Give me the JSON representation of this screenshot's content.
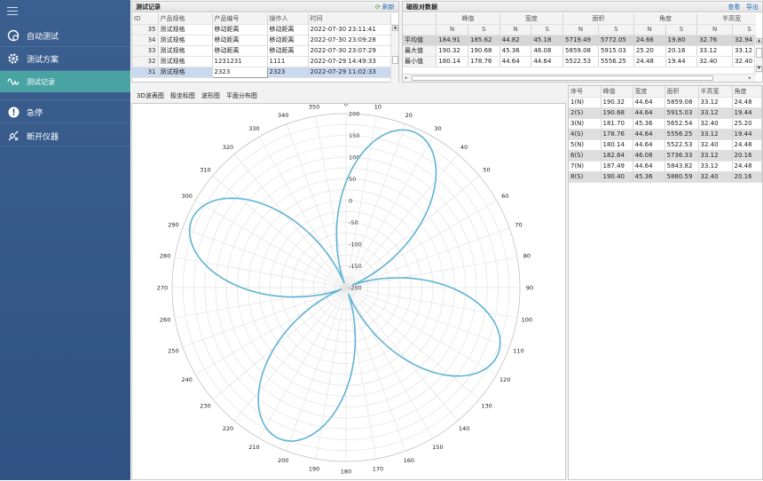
{
  "sidebar": {
    "items": [
      {
        "label": "自动测试",
        "icon": "auto-test-icon"
      },
      {
        "label": "测试方案",
        "icon": "gear-icon"
      },
      {
        "label": "测试记录",
        "icon": "wave-icon"
      },
      {
        "label": "急停",
        "icon": "alert-icon"
      },
      {
        "label": "断开仪器",
        "icon": "disconnect-icon"
      }
    ],
    "active_color": "#4aa3a3"
  },
  "records": {
    "title": "测试记录",
    "refresh_label": "刷新",
    "columns": [
      "ID",
      "产品规格",
      "产品编号",
      "操作人",
      "时间"
    ],
    "rows": [
      [
        "35",
        "测试规格",
        "移动距离",
        "移动距离",
        "2022-07-30 23:11:41"
      ],
      [
        "34",
        "测试规格",
        "移动距离",
        "移动距离",
        "2022-07-30 23:09:28"
      ],
      [
        "33",
        "测试规格",
        "移动距离",
        "移动距离",
        "2022-07-30 23:07:29"
      ],
      [
        "32",
        "测试规格",
        "1231231",
        "1111",
        "2022-07-29 14:49:33"
      ],
      [
        "31",
        "测试规格",
        "2323",
        "2323",
        "2022-07-29 11:02:33"
      ]
    ]
  },
  "magnetic": {
    "title": "磁极对数据",
    "view_label": "查看",
    "export_label": "导出",
    "groups": [
      "峰值",
      "宽度",
      "面积",
      "角度",
      "半高宽"
    ],
    "sub": [
      "N",
      "S",
      "N",
      "S",
      "N",
      "S",
      "N",
      "S",
      "N",
      "S"
    ],
    "rows": [
      {
        "label": "平均值",
        "values": [
          "184.91",
          "185.62",
          "44.82",
          "45.18",
          "5719.49",
          "5772.05",
          "24.66",
          "19.80",
          "32.76",
          "32.94"
        ]
      },
      {
        "label": "最大值",
        "values": [
          "190.32",
          "190.68",
          "45.36",
          "46.08",
          "5859.08",
          "5915.03",
          "25.20",
          "20.16",
          "33.12",
          "33.12"
        ]
      },
      {
        "label": "最小值",
        "values": [
          "180.14",
          "178.76",
          "44.64",
          "44.64",
          "5522.53",
          "5556.25",
          "24.48",
          "19.44",
          "32.40",
          "32.40"
        ]
      }
    ]
  },
  "tabs": [
    "3D波表图",
    "极坐标图",
    "波形图",
    "平面分布图"
  ],
  "results": {
    "columns": [
      "序号",
      "峰值",
      "宽度",
      "面积",
      "半高宽",
      "角度"
    ],
    "rows": [
      [
        "1(N)",
        "190.32",
        "44.64",
        "5859.08",
        "33.12",
        "24.48"
      ],
      [
        "2(S)",
        "190.68",
        "44.64",
        "5915.03",
        "33.12",
        "19.44"
      ],
      [
        "3(N)",
        "181.70",
        "45.36",
        "5652.54",
        "32.40",
        "25.20"
      ],
      [
        "4(S)",
        "178.76",
        "44.64",
        "5556.25",
        "33.12",
        "19.44"
      ],
      [
        "5(N)",
        "180.14",
        "44.64",
        "5522.53",
        "32.40",
        "24.48"
      ],
      [
        "6(S)",
        "182.64",
        "46.08",
        "5736.33",
        "33.12",
        "20.16"
      ],
      [
        "7(N)",
        "187.49",
        "44.64",
        "5843.82",
        "33.12",
        "24.48"
      ],
      [
        "8(S)",
        "190.40",
        "45.36",
        "5880.59",
        "32.40",
        "20.16"
      ]
    ]
  },
  "chart_data": {
    "type": "polar-line",
    "angle_ticks": [
      "0",
      "10",
      "20",
      "30",
      "40",
      "50",
      "60",
      "70",
      "80",
      "90",
      "100",
      "110",
      "120",
      "130",
      "140",
      "150",
      "160",
      "170",
      "180",
      "190",
      "200",
      "210",
      "220",
      "230",
      "240",
      "250",
      "260",
      "270",
      "280",
      "290",
      "300",
      "310",
      "320",
      "330",
      "340",
      "350"
    ],
    "radial_ticks": [
      "200",
      "150",
      "100",
      "50",
      "0",
      "-50",
      "-100",
      "-150",
      "-200"
    ],
    "rlim": [
      -200,
      200
    ],
    "lobes": [
      {
        "center_deg": 24,
        "peak": 190.32,
        "width_deg": 44.64
      },
      {
        "center_deg": 114,
        "peak": 181.7,
        "width_deg": 45.36
      },
      {
        "center_deg": 204,
        "peak": 180.14,
        "width_deg": 44.64
      },
      {
        "center_deg": 294,
        "peak": 187.49,
        "width_deg": 44.64
      }
    ],
    "line_color": "#5fb3d4",
    "grid": true
  }
}
